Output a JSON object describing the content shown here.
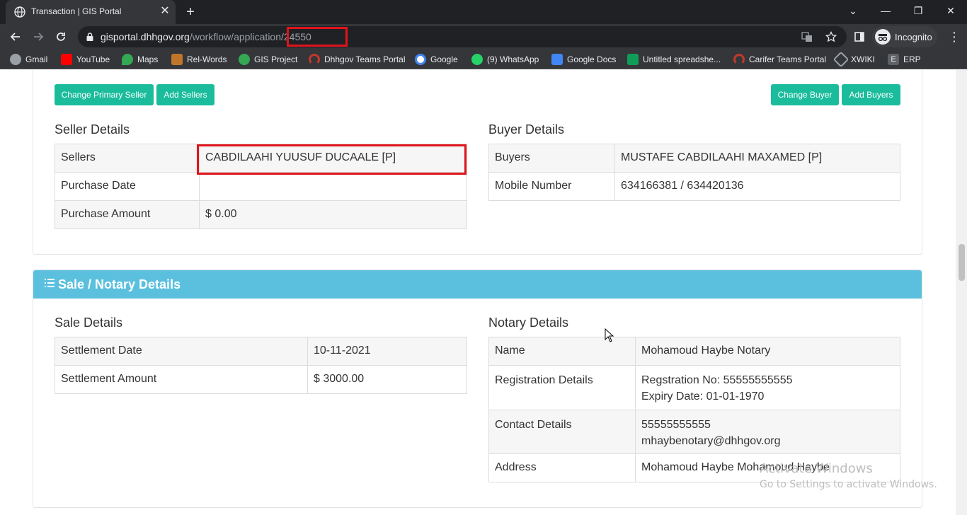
{
  "browser": {
    "tab_title": "Transaction | GIS Portal",
    "tab_close": "✕",
    "new_tab": "+",
    "window_controls": {
      "minimize": "—",
      "restore": "❐",
      "close": "✕",
      "tab_search": "⌄"
    },
    "url_host": "gisportal.dhhgov.org",
    "url_path": "/workflow/application/24550",
    "profile_label": "Incognito",
    "bookmarks": [
      {
        "label": "Gmail",
        "icon": "gmail-icon",
        "color": "#9aa0a6"
      },
      {
        "label": "YouTube",
        "icon": "youtube-icon",
        "color": "#ff0000"
      },
      {
        "label": "Maps",
        "icon": "maps-icon",
        "color": "#34a853"
      },
      {
        "label": "Rel-Words",
        "icon": "rel-words-icon",
        "color": "#c0762a"
      },
      {
        "label": "GIS Project",
        "icon": "gis-project-icon",
        "color": "#34a853"
      },
      {
        "label": "Dhhgov Teams Portal",
        "icon": "teams-portal-icon",
        "color": "#c0392b"
      },
      {
        "label": "Google",
        "icon": "google-icon",
        "color": "#4285f4"
      },
      {
        "label": "(9) WhatsApp",
        "icon": "whatsapp-icon",
        "color": "#25d366"
      },
      {
        "label": "Google Docs",
        "icon": "google-docs-icon",
        "color": "#4285f4"
      },
      {
        "label": "Untitled spreadshe...",
        "icon": "google-sheets-icon",
        "color": "#0f9d58"
      },
      {
        "label": "Carifer Teams Portal",
        "icon": "carifer-portal-icon",
        "color": "#c0392b"
      },
      {
        "label": "XWIKI",
        "icon": "xwiki-icon",
        "color": "#9aa0a6"
      },
      {
        "label": "ERP",
        "icon": "erp-icon",
        "color": "#5f6368"
      }
    ]
  },
  "parties": {
    "buttons": {
      "change_primary_seller": "Change Primary Seller",
      "add_sellers": "Add Sellers",
      "change_buyer": "Change Buyer",
      "add_buyers": "Add Buyers"
    },
    "seller": {
      "title": "Seller Details",
      "rows": [
        {
          "label": "Sellers",
          "value": "CABDILAAHI YUUSUF DUCAALE [P]"
        },
        {
          "label": "Purchase Date",
          "value": ""
        },
        {
          "label": "Purchase Amount",
          "value": "$ 0.00"
        }
      ]
    },
    "buyer": {
      "title": "Buyer Details",
      "rows": [
        {
          "label": "Buyers",
          "value": "MUSTAFE CABDILAAHI MAXAMED [P]"
        },
        {
          "label": "Mobile Number",
          "value": "634166381 / 634420136"
        }
      ]
    }
  },
  "sale_notary": {
    "panel_title": "Sale / Notary Details",
    "sale": {
      "title": "Sale Details",
      "rows": [
        {
          "label": "Settlement Date",
          "value": "10-11-2021"
        },
        {
          "label": "Settlement Amount",
          "value": "$ 3000.00"
        }
      ]
    },
    "notary": {
      "title": "Notary Details",
      "rows": [
        {
          "label": "Name",
          "value": "Mohamoud Haybe Notary"
        },
        {
          "label": "Registration Details",
          "value": "Regstration No: 55555555555",
          "value2": "Expiry Date: 01-01-1970"
        },
        {
          "label": "Contact Details",
          "value": "55555555555",
          "value2": "mhaybenotary@dhhgov.org"
        },
        {
          "label": "Address",
          "value": "Mohamoud Haybe Mohamoud Haybe"
        }
      ]
    }
  },
  "watermark": {
    "line1": "Activate Windows",
    "line2": "Go to Settings to activate Windows."
  },
  "colors": {
    "button": "#1abc9c",
    "panel_header": "#5bc0de",
    "highlight": "#e0141b"
  }
}
